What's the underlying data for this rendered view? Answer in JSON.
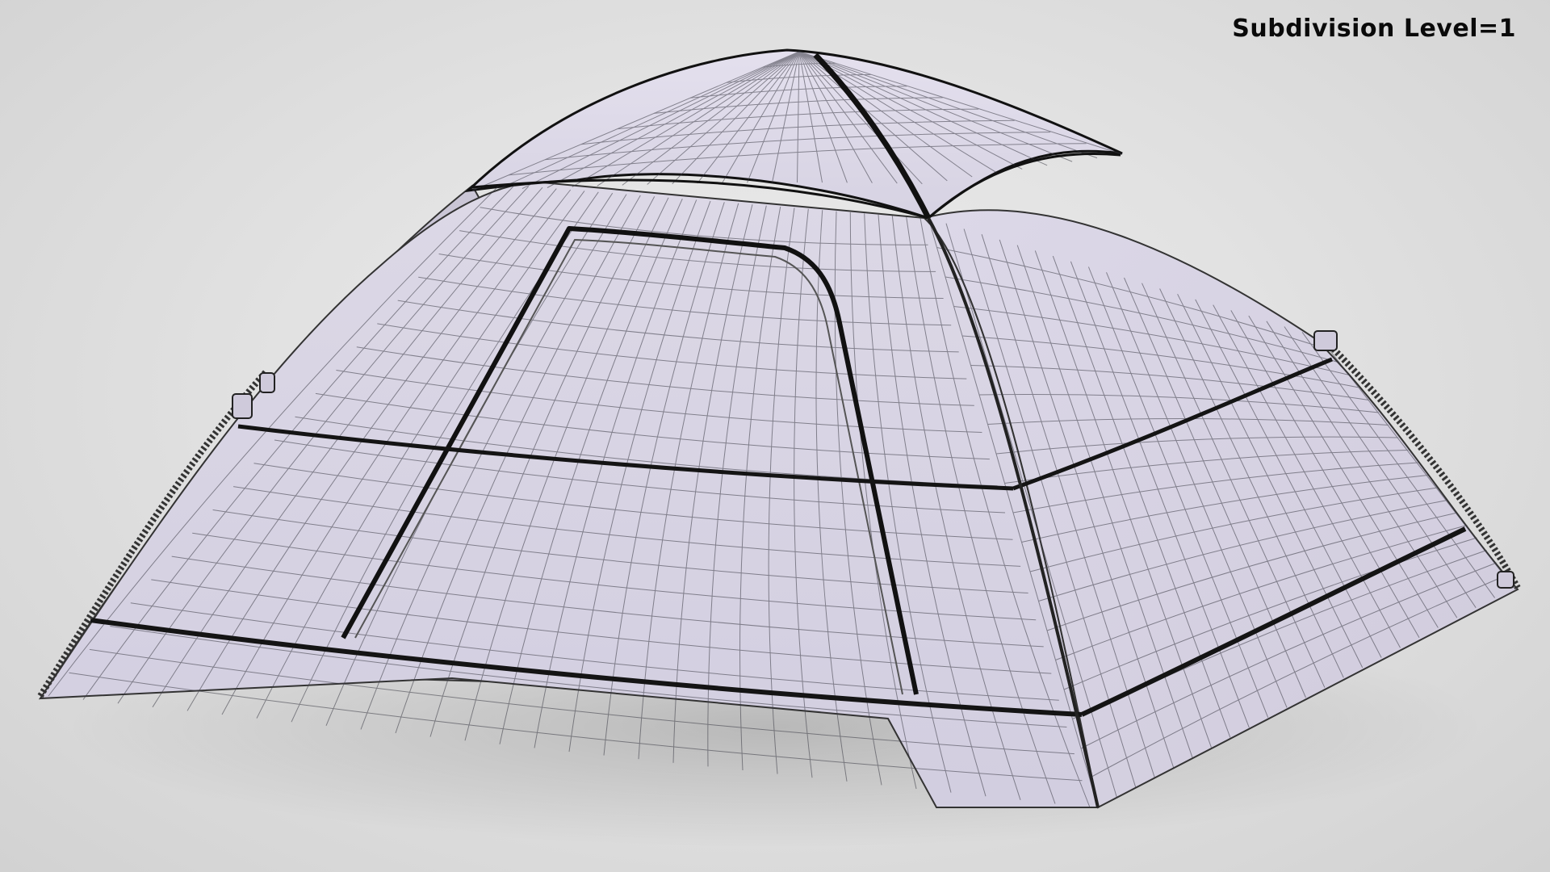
{
  "overlay": {
    "label": "Subdivision Level=1"
  },
  "scene": {
    "subject": "tent-wireframe-model",
    "colors": {
      "surface": "#d8d4e2",
      "surface_shadow": "#c3bed0",
      "wire": "#3a3a44",
      "seam": "#111111",
      "background": "#e4e4e4"
    }
  }
}
